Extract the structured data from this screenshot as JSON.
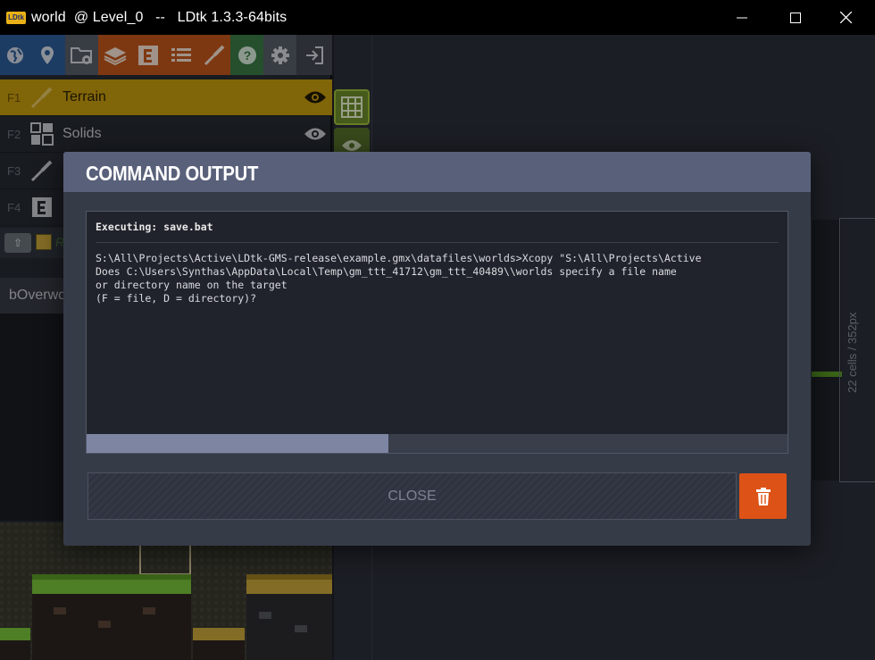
{
  "window": {
    "logo": "LDtk",
    "title": "world  @ Level_0   --   LDtk 1.3.3-64bits"
  },
  "toolbar": {
    "icons": [
      "world-icon",
      "pin-icon",
      "project-settings-icon",
      "layers-icon",
      "entities-icon",
      "enums-icon",
      "tilesets-icon",
      "help-icon",
      "gear-icon",
      "exit-icon"
    ],
    "colors": [
      "#2d5c99",
      "#2d5c99",
      "#575d68",
      "#c2571b",
      "#c2571b",
      "#c2571b",
      "#c2571b",
      "#3a7a45",
      "#575d68",
      "#434851"
    ]
  },
  "layers": [
    {
      "key": "F1",
      "label": "Terrain",
      "icon": "brush-icon"
    },
    {
      "key": "F2",
      "label": "Solids",
      "icon": "intgrid-icon"
    },
    {
      "key": "F3",
      "label": "",
      "icon": "brush-icon"
    },
    {
      "key": "F4",
      "label": "",
      "icon": "entity-icon"
    }
  ],
  "mini": {
    "button": "⇧",
    "text": "R"
  },
  "level_name_fragment": "bOverwo",
  "ruler_label": "22 cells / 352px",
  "modal": {
    "title": "COMMAND OUTPUT",
    "executing": "Executing: save.bat",
    "lines": [
      "S:\\All\\Projects\\Active\\LDtk-GMS-release\\example.gmx\\datafiles\\worlds>Xcopy \"S:\\All\\Projects\\Active",
      "Does C:\\Users\\Synthas\\AppData\\Local\\Temp\\gm_ttt_41712\\gm_ttt_40489\\\\worlds specify a file name",
      "or directory name on the target",
      "(F = file, D = directory)?"
    ],
    "progress": 0.43,
    "close_label": "CLOSE",
    "trash_icon": "trash-icon"
  },
  "colors": {
    "accent": "#c79b0f",
    "danger": "#dd5216",
    "header": "#59607a"
  }
}
